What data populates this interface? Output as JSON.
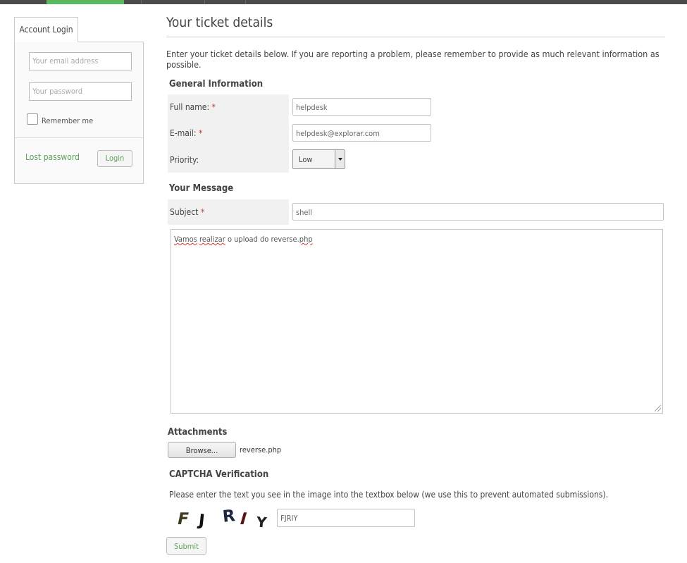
{
  "sidebar": {
    "tab_label": "Account Login",
    "email_placeholder": "Your email address",
    "password_placeholder": "Your password",
    "remember_label": "Remember me",
    "lost_password_label": "Lost password",
    "login_button_label": "Login"
  },
  "main": {
    "title": "Your ticket details",
    "intro": "Enter your ticket details below. If you are reporting a problem, please remember to provide as much relevant information as possible.",
    "general_info": {
      "heading": "General Information",
      "fullname_label": "Full name:",
      "fullname_value": "helpdesk",
      "email_label": "E-mail:",
      "email_value": "helpdesk@explorar.com",
      "priority_label": "Priority:",
      "priority_value": "Low",
      "required_mark": "*"
    },
    "message": {
      "heading": "Your Message",
      "subject_label": "Subject",
      "subject_value": "shell",
      "body_words": [
        "Vamos",
        " ",
        "realizar",
        " o upload do reverse.",
        "php"
      ]
    },
    "attachments": {
      "heading": "Attachments",
      "browse_label": "Browse...",
      "file_name": "reverse.php"
    },
    "captcha": {
      "heading": "CAPTCHA Verification",
      "help": "Please enter the text you see in the image into the textbox below (we use this to prevent automated submissions).",
      "image_chars": [
        "F",
        "J",
        "R",
        "I",
        "Y"
      ],
      "input_value": "FJRIY"
    },
    "submit_label": "Submit"
  }
}
